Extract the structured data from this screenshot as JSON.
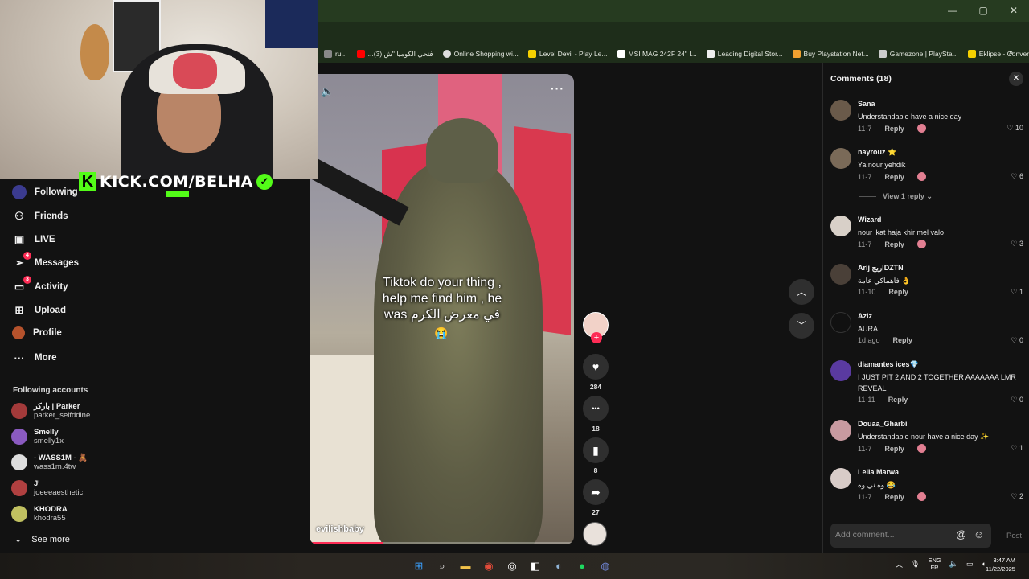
{
  "kick": {
    "logo": "K",
    "url": "KICK.COM/BELHA",
    "check": "✓"
  },
  "browser": {
    "window_controls": [
      "—",
      "▢",
      "✕"
    ],
    "bookmarks": [
      {
        "label": "ru...",
        "color": "#888888"
      },
      {
        "label": "...فتحي الكوميا \"ش (3)",
        "color": "#ff0000"
      },
      {
        "label": "Online Shopping wi...",
        "color": "#dddddd"
      },
      {
        "label": "Level Devil - Play Le...",
        "color": "#f5d000"
      },
      {
        "label": "MSI MAG 242F 24\" I...",
        "color": "#ffffff"
      },
      {
        "label": "Leading Digital Stor...",
        "color": "#eeeeee"
      },
      {
        "label": "Buy Playstation Net...",
        "color": "#f0a030"
      },
      {
        "label": "Gamezone | PlaySta...",
        "color": "#cccccc"
      },
      {
        "label": "Eklipse - Convert Tw...",
        "color": "#f5d000"
      }
    ],
    "more": "»"
  },
  "sidebar": {
    "nav": [
      {
        "label": "Following",
        "icon": "following-icon",
        "glyph": "●"
      },
      {
        "label": "Friends",
        "icon": "friends-icon",
        "glyph": "👥"
      },
      {
        "label": "LIVE",
        "icon": "live-icon",
        "glyph": "▣"
      },
      {
        "label": "Messages",
        "icon": "messages-icon",
        "glyph": "✈",
        "badge": "4"
      },
      {
        "label": "Activity",
        "icon": "activity-icon",
        "glyph": "▭",
        "badge": "3"
      },
      {
        "label": "Upload",
        "icon": "upload-icon",
        "glyph": "⊞"
      },
      {
        "label": "Profile",
        "icon": "profile-icon",
        "glyph": "●"
      },
      {
        "label": "More",
        "icon": "more-icon",
        "glyph": "···"
      }
    ],
    "following_title": "Following accounts",
    "accounts": [
      {
        "name": "باركر | Parker",
        "handle": "parker_seifddine",
        "color": "#a33a3a"
      },
      {
        "name": "Smelly",
        "handle": "smelly1x",
        "color": "#8a5ac0"
      },
      {
        "name": "- WASS1M - 🧸",
        "handle": "wass1m.4tw",
        "color": "#dddddd"
      },
      {
        "name": "J'",
        "handle": "joeeeaesthetic",
        "color": "#b04040"
      },
      {
        "name": "KHODRA",
        "handle": "khodra55",
        "color": "#c0c060"
      }
    ],
    "see_more": "See more",
    "see_more_glyph": "⌄"
  },
  "video": {
    "caption_l1": "Tiktok do your thing ,",
    "caption_l2": "help me find him , he",
    "caption_l3": "was في معرض الكرم",
    "emoji": "😭",
    "author": "evilishbaby",
    "volume_glyph": "🔈",
    "more_glyph": "···",
    "progress": 0.28
  },
  "actions": {
    "follow_plus": "+",
    "like": {
      "glyph": "♥",
      "count": "284"
    },
    "comment": {
      "glyph": "•••",
      "count": "18"
    },
    "save": {
      "glyph": "▮",
      "count": "8"
    },
    "share": {
      "glyph": "➦",
      "count": "27"
    }
  },
  "nav_buttons": {
    "up": "︿",
    "down": "﹀"
  },
  "comments": {
    "title": "Comments (18)",
    "close": "✕",
    "items": [
      {
        "name": "Sana",
        "text": "Understandable have a nice day",
        "date": "11-7",
        "reply": "Reply",
        "likes": "♡ 10",
        "color": "#6a5a4a",
        "mini": true
      },
      {
        "name": "nayrouz ⭐",
        "text": "Ya nour yehdik",
        "date": "11-7",
        "reply": "Reply",
        "likes": "♡ 6",
        "color": "#7a6a58",
        "mini": true
      },
      {
        "name": "Wizard",
        "text": "nour lkat haja khir mel valo",
        "date": "11-7",
        "reply": "Reply",
        "likes": "♡ 3",
        "color": "#d8d0c8",
        "mini": true
      },
      {
        "name": "Arij اريجDZTN",
        "text": "فاهماكي عامة 👌",
        "date": "11-10",
        "reply": "Reply",
        "likes": "♡ 1",
        "color": "#4a4038",
        "mini": false
      },
      {
        "name": "Aziz",
        "text": "AURA",
        "date": "1d ago",
        "reply": "Reply",
        "likes": "♡ 0",
        "color": "#111111",
        "mini": false
      },
      {
        "name": "diamantes ices💎",
        "text": "I JUST PIT 2 AND 2 TOGETHER AAAAAAA LMR REVEAL",
        "date": "11-11",
        "reply": "Reply",
        "likes": "♡ 0",
        "color": "#5a3aa0",
        "mini": false
      },
      {
        "name": "Douaa_Gharbi",
        "text": "Understandable nour have a nice day ✨",
        "date": "11-7",
        "reply": "Reply",
        "likes": "♡ 1",
        "color": "#c89aa0",
        "mini": true
      },
      {
        "name": "Lella Marwa",
        "text": "وه ني وه 😂",
        "date": "11-7",
        "reply": "Reply",
        "likes": "♡ 2",
        "color": "#d8ccc8",
        "mini": true
      }
    ],
    "view_reply": "View 1 reply ⌄",
    "input_placeholder": "Add comment...",
    "mention_glyph": "@",
    "emoji_glyph": "☺",
    "post": "Post"
  },
  "taskbar": {
    "lang_top": "ENG",
    "lang_bottom": "FR",
    "time": "3:47 AM",
    "date": "11/22/2025"
  }
}
